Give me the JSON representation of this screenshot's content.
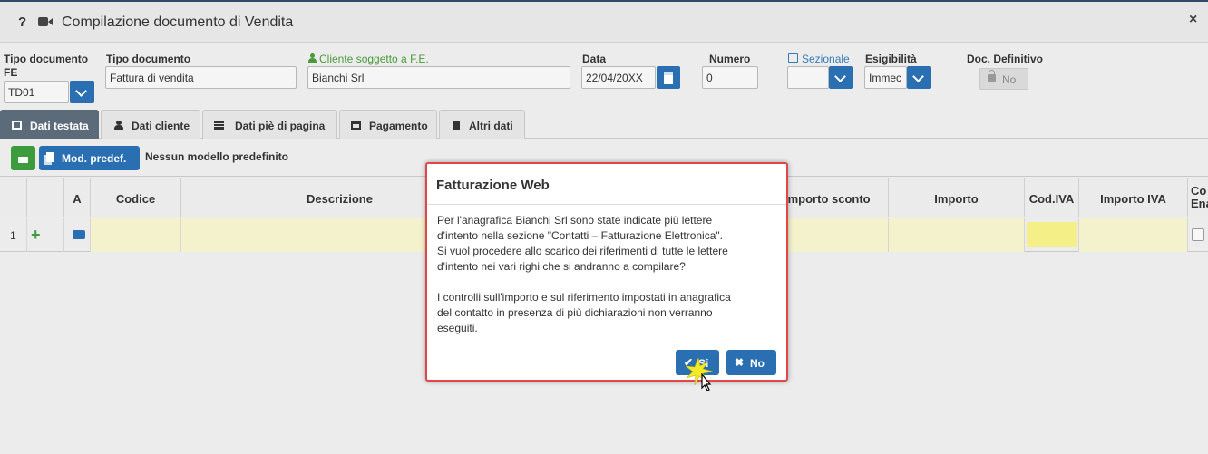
{
  "window": {
    "help": "?",
    "title": "Compilazione documento di Vendita",
    "close": "×"
  },
  "form": {
    "tipo_fe_label": "Tipo documento FE",
    "tipo_fe_value": "TD01",
    "tipo_doc_label": "Tipo documento",
    "tipo_doc_value": "Fattura di vendita",
    "cliente_label": "Cliente soggetto a F.E.",
    "cliente_value": "Bianchi Srl",
    "data_label": "Data",
    "data_value": "22/04/20XX",
    "numero_label": "Numero",
    "numero_value": "0",
    "sezionale_label": "Sezionale",
    "sezionale_value": "",
    "esigibilita_label": "Esigibilità",
    "esigibilita_value": "Immec",
    "doc_def_label": "Doc. Definitivo",
    "doc_def_value": "No"
  },
  "tabs": [
    {
      "label": "Dati testata",
      "icon": "table-icon"
    },
    {
      "label": "Dati cliente",
      "icon": "user-icon"
    },
    {
      "label": "Dati piè di pagina",
      "icon": "server-icon"
    },
    {
      "label": "Pagamento",
      "icon": "calendar-icon"
    },
    {
      "label": "Altri dati",
      "icon": "file-icon"
    }
  ],
  "toolbar": {
    "mod_predef": "Mod. predef.",
    "no_model": "Nessun modello predefinito"
  },
  "grid": {
    "columns": [
      "A",
      "Codice",
      "Descrizione",
      "Importo sconto",
      "Importo",
      "Cod.IVA",
      "Importo IVA",
      "Co Ena"
    ],
    "row_number": "1",
    "add_symbol": "+"
  },
  "dialog": {
    "title": "Fatturazione Web",
    "lines": [
      "Per l'anagrafica Bianchi Srl sono state indicate più lettere",
      "d'intento nella sezione \"Contatti – Fatturazione Elettronica\".",
      "Si vuol procedere allo scarico dei riferimenti di tutte le lettere",
      "d'intento nei vari righi che si andranno a compilare?",
      "",
      "I controlli sull'importo e sul riferimento impostati in anagrafica",
      "del contatto in presenza di più dichiarazioni non verranno",
      "eseguiti."
    ],
    "yes_label": "Si",
    "no_label": "No",
    "yes_icon": "✔",
    "no_icon": "✖"
  },
  "colors": {
    "primary": "#2b6fb3",
    "success": "#3c9b3c",
    "highlight_border": "#e04848",
    "tab_active": "#5b6b7a"
  }
}
